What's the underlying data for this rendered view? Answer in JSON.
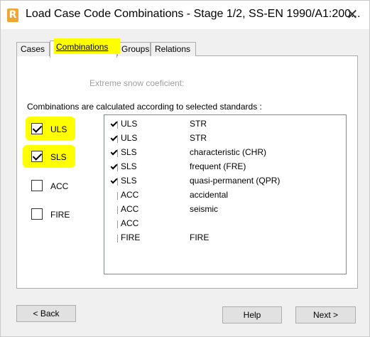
{
  "window": {
    "title": "Load Case Code Combinations - Stage 1/2, SS-EN 1990/A1:200...",
    "app_icon_letter": "R",
    "close_glyph": "✕"
  },
  "tabs": [
    {
      "label": "Cases",
      "active": false
    },
    {
      "label": "Combinations",
      "active": true
    },
    {
      "label": "Groups",
      "active": false
    },
    {
      "label": "Relations",
      "active": false
    }
  ],
  "highlight_color": "#ffff00",
  "snow_label": "Extreme snow coeficient:",
  "combo_heading": "Combinations are calculated according to selected standards :",
  "standards": [
    {
      "label": "ULS",
      "checked": true
    },
    {
      "label": "SLS",
      "checked": true
    },
    {
      "label": "ACC",
      "checked": false
    },
    {
      "label": "FIRE",
      "checked": false
    }
  ],
  "combination_list": [
    {
      "code": "ULS",
      "description": "STR",
      "checked": true
    },
    {
      "code": "ULS",
      "description": "STR",
      "checked": true
    },
    {
      "code": "SLS",
      "description": "characteristic (CHR)",
      "checked": true
    },
    {
      "code": "SLS",
      "description": "frequent (FRE)",
      "checked": true
    },
    {
      "code": "SLS",
      "description": "quasi-permanent (QPR)",
      "checked": true
    },
    {
      "code": "ACC",
      "description": "accidental",
      "checked": false
    },
    {
      "code": "ACC",
      "description": "seismic",
      "checked": false
    },
    {
      "code": "ACC",
      "description": "",
      "checked": false
    },
    {
      "code": "FIRE",
      "description": "FIRE",
      "checked": false
    }
  ],
  "buttons": {
    "back": "< Back",
    "help": "Help",
    "next": "Next >"
  }
}
